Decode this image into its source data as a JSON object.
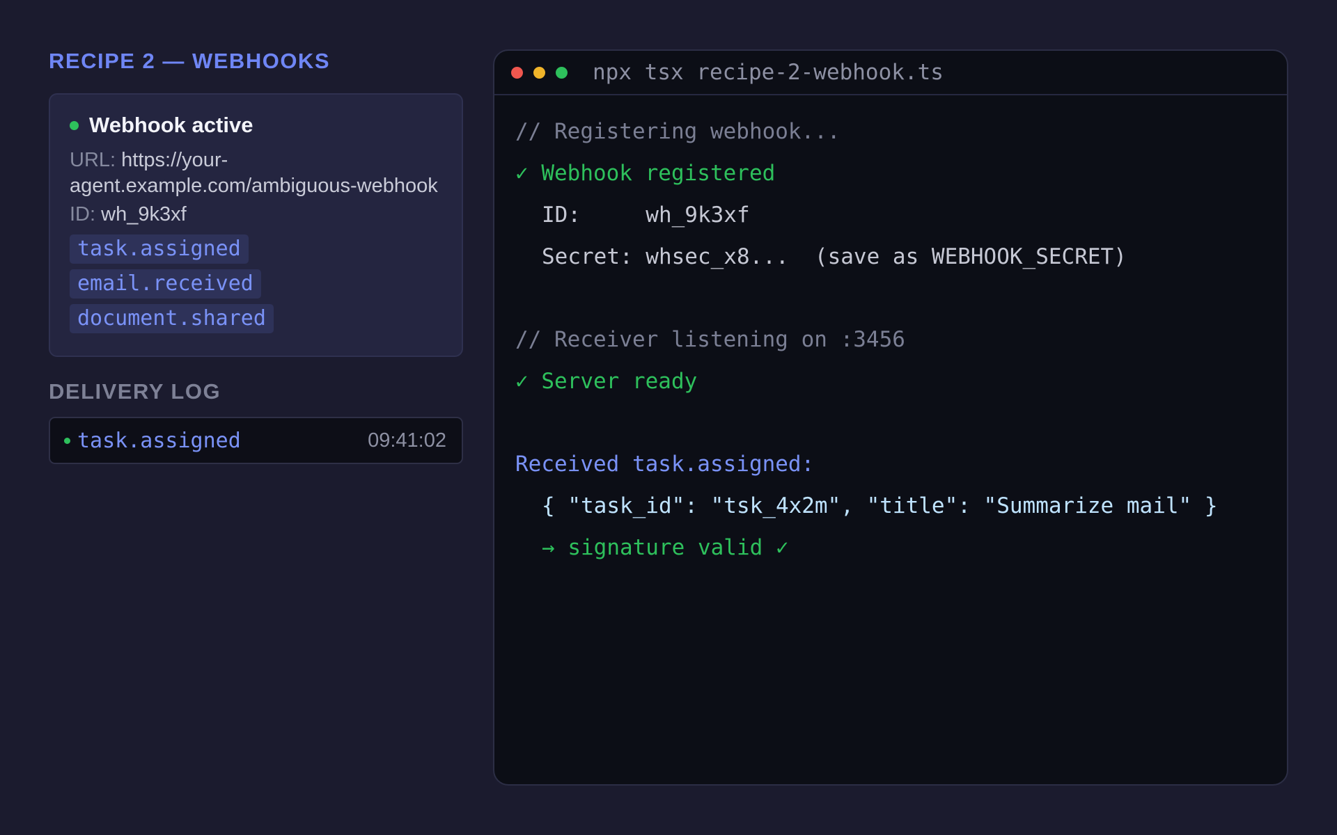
{
  "recipe": {
    "title": "RECIPE 2 — WEBHOOKS"
  },
  "webhook": {
    "status": "Webhook active",
    "status_color": "#2ec05c",
    "url_label": "URL:",
    "url": "https://your-agent.example.com/ambiguous-webhook",
    "id_label": "ID:",
    "id": "wh_9k3xf",
    "events": [
      "task.assigned",
      "email.received",
      "document.shared"
    ]
  },
  "delivery_log": {
    "title": "DELIVERY LOG",
    "entries": [
      {
        "event": "task.assigned",
        "time": "09:41:02"
      }
    ]
  },
  "terminal": {
    "command": "npx tsx recipe-2-webhook.ts",
    "lines": {
      "l1": "// Registering webhook...",
      "l2": "✓ Webhook registered",
      "l3": "ID:     wh_9k3xf",
      "l4": "Secret: whsec_x8...  (save as WEBHOOK_SECRET)",
      "l5": "// Receiver listening on :3456",
      "l6": "✓ Server ready",
      "l7": "Received task.assigned:",
      "l8": "{ \"task_id\": \"tsk_4x2m\", \"title\": \"Summarize mail\" }",
      "l9": "→ signature valid ✓"
    }
  },
  "colors": {
    "accent": "#6f86f5",
    "success": "#2ec05c",
    "background": "#1b1b2e",
    "terminal_bg": "#0c0e16"
  }
}
